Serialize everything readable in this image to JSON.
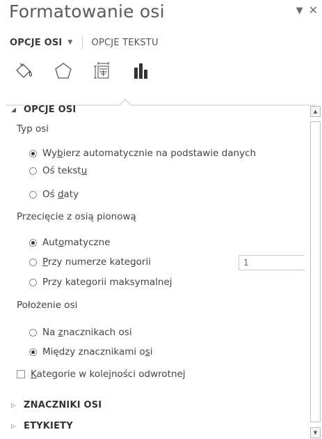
{
  "pane": {
    "title": "Formatowanie osi",
    "dropdown_glyph": "▼",
    "close_glyph": "✕"
  },
  "tabs": [
    {
      "label": "OPCJE OSI",
      "active": true,
      "arrow": "▼"
    },
    {
      "label": "OPCJE TEKSTU",
      "active": false
    }
  ],
  "icons": [
    "fill-line-icon",
    "effects-pentagon-icon",
    "size-properties-icon",
    "axis-options-chart-icon"
  ],
  "sections": {
    "axis_options": {
      "label": "OPCJE OSI",
      "expanded": true,
      "tri": "◢"
    },
    "tick_marks": {
      "label": "ZNACZNIKI OSI",
      "expanded": false,
      "tri": "▷"
    },
    "labels": {
      "label": "ETYKIETY",
      "expanded": false,
      "tri": "▷"
    }
  },
  "axis_type": {
    "label": "Typ osi",
    "options": [
      {
        "pre": "Wy",
        "u": "b",
        "post": "ierz automatycznie na podstawie danych",
        "selected": true
      },
      {
        "pre": "Oś tekst",
        "u": "u",
        "post": "",
        "selected": false
      },
      {
        "pre": "Oś ",
        "u": "d",
        "post": "aty",
        "selected": false
      }
    ]
  },
  "crossing": {
    "label": "Przecięcie z osią pionową",
    "options": [
      {
        "pre": "Aut",
        "u": "o",
        "post": "matyczne",
        "selected": true
      },
      {
        "pre": "",
        "u": "P",
        "post": "rzy numerze kategorii",
        "selected": false
      },
      {
        "pre": "Przy kategorii maksymalnej",
        "u": "",
        "post": "",
        "selected": false
      }
    ],
    "category_number": "1"
  },
  "position": {
    "label": "Położenie osi",
    "options": [
      {
        "pre": "Na ",
        "u": "z",
        "post": "nacznikach osi",
        "selected": false
      },
      {
        "pre": "Między znacznikami o",
        "u": "s",
        "post": "i",
        "selected": true
      }
    ]
  },
  "reverse_order": {
    "u": "K",
    "post": "ategorie w kolejności odwrotnej",
    "checked": false
  },
  "scroll": {
    "up_glyph": "▲",
    "down_glyph": "▼"
  },
  "colors": {
    "accent": "#333333",
    "text": "#444444",
    "border": "#c8c8c8"
  }
}
